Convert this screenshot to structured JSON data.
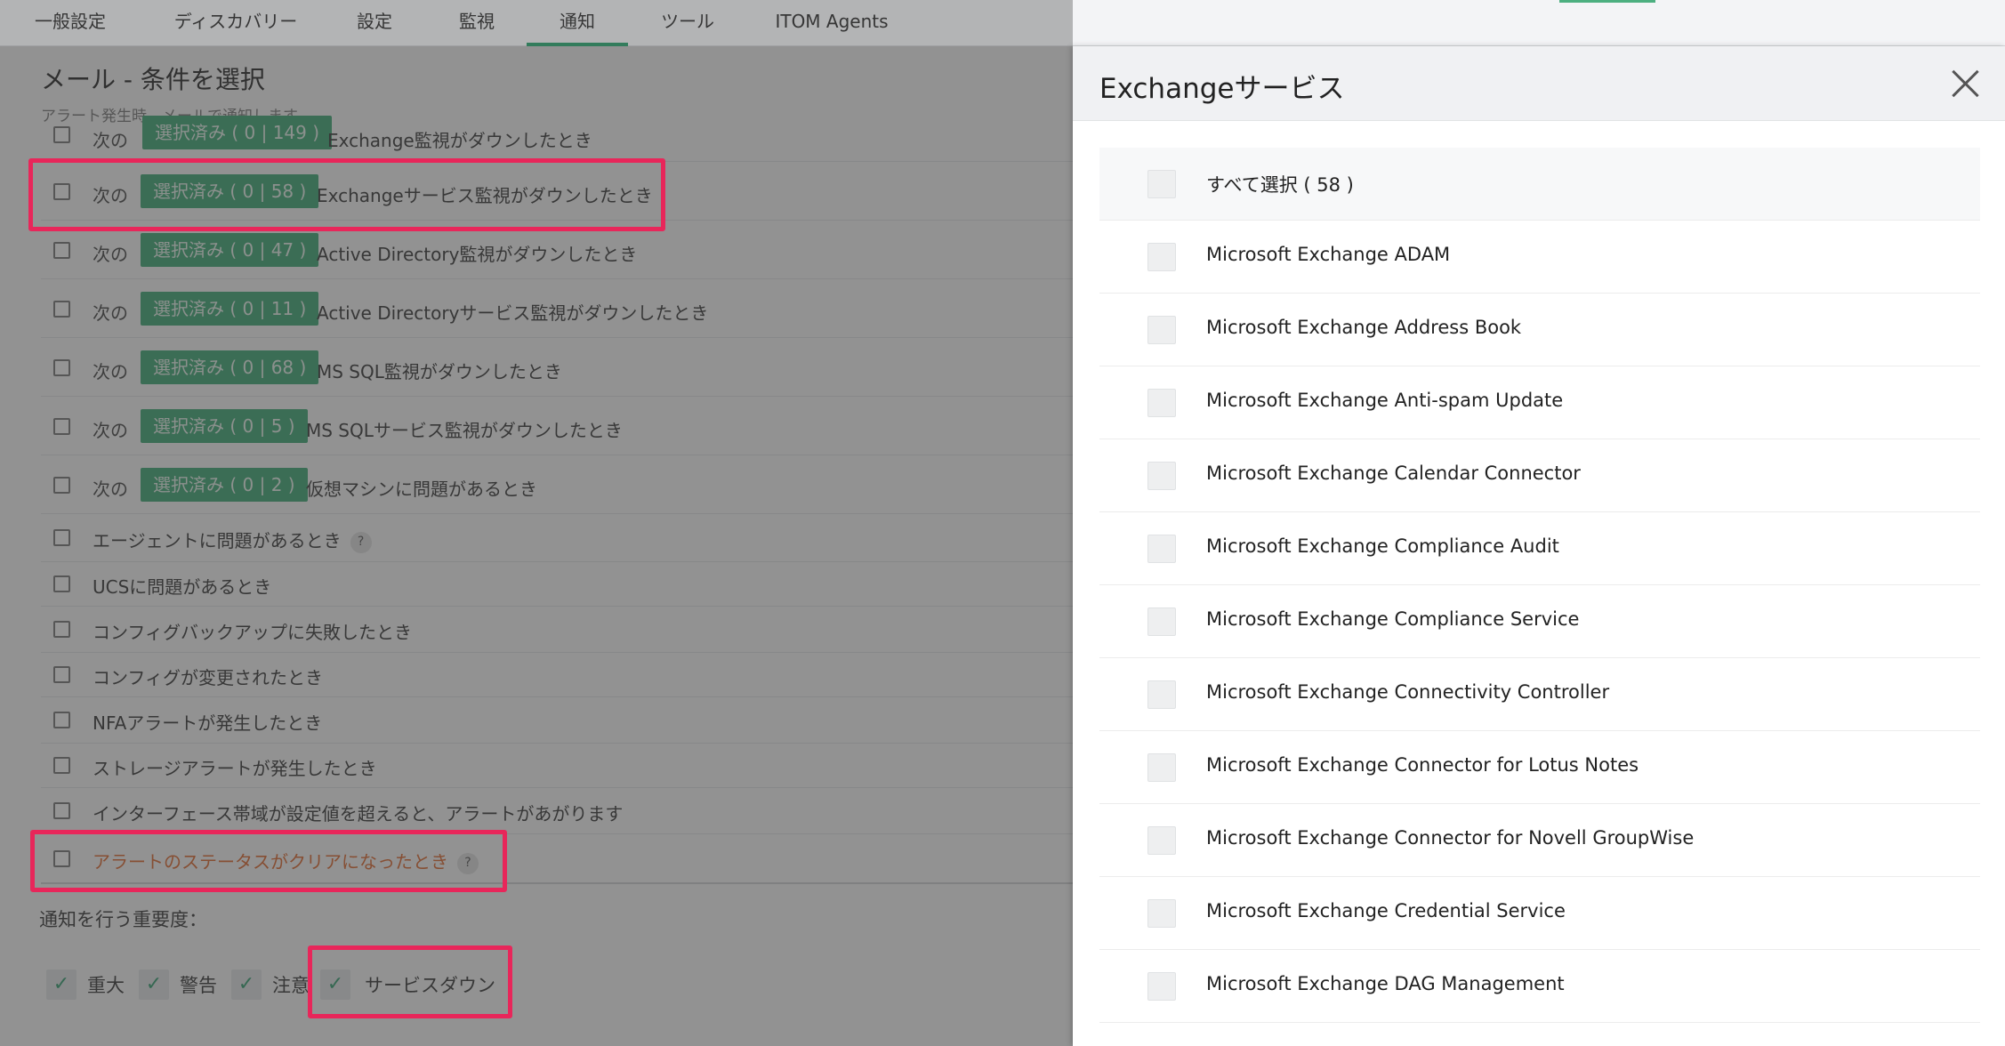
{
  "nav": {
    "tabs": [
      "一般設定",
      "ディスカバリー",
      "設定",
      "監視",
      "通知",
      "ツール",
      "ITOM Agents"
    ],
    "active": "通知"
  },
  "left": {
    "title": "メール - 条件を選択",
    "subtitle": "アラート発生時、メールで通知します。",
    "prefix": "次の",
    "rows": [
      {
        "badge": "選択済み ( 0 | 149 )",
        "label": "Exchange監視がダウンしたとき"
      },
      {
        "badge": "選択済み ( 0 | 58 )",
        "label": "Exchangeサービス監視がダウンしたとき"
      },
      {
        "badge": "選択済み ( 0 | 47 )",
        "label": "Active Directory監視がダウンしたとき"
      },
      {
        "badge": "選択済み ( 0 | 11 )",
        "label": "Active Directoryサービス監視がダウンしたとき"
      },
      {
        "badge": "選択済み ( 0 | 68 )",
        "label": "MS SQL監視がダウンしたとき"
      },
      {
        "badge": "選択済み ( 0 | 5 )",
        "label": "MS SQLサービス監視がダウンしたとき"
      },
      {
        "badge": "選択済み ( 0 | 2 )",
        "label": "仮想マシンに問題があるとき"
      }
    ],
    "simple_rows": [
      {
        "label": "エージェントに問題があるとき",
        "help": "?"
      },
      {
        "label": "UCSに問題があるとき"
      },
      {
        "label": "コンフィグバックアップに失敗したとき"
      },
      {
        "label": "コンフィグが変更されたとき"
      },
      {
        "label": "NFAアラートが発生したとき"
      },
      {
        "label": "ストレージアラートが発生したとき"
      },
      {
        "label": "インターフェース帯域が設定値を超えると、アラートがあがります"
      },
      {
        "label": "アラートのステータスがクリアになったとき",
        "help": "?",
        "color": "#e0662a"
      }
    ],
    "severity_title": "通知を行う重要度：",
    "severities": [
      {
        "label": "重大",
        "checked": true
      },
      {
        "label": "警告",
        "checked": true
      },
      {
        "label": "注意",
        "checked": true
      },
      {
        "label": "サービスダウン",
        "checked": true
      }
    ],
    "check_glyph": "✓"
  },
  "panel": {
    "title": "Exchangeサービス",
    "select_all": "すべて選択 ( 58 )",
    "items": [
      "Microsoft Exchange ADAM",
      "Microsoft Exchange Address Book",
      "Microsoft Exchange Anti-spam Update",
      "Microsoft Exchange Calendar Connector",
      "Microsoft Exchange Compliance Audit",
      "Microsoft Exchange Compliance Service",
      "Microsoft Exchange Connectivity Controller",
      "Microsoft Exchange Connector for Lotus Notes",
      "Microsoft Exchange Connector for Novell GroupWise",
      "Microsoft Exchange Credential Service",
      "Microsoft Exchange DAG Management"
    ]
  },
  "colors": {
    "accent": "#2f9e6e",
    "badge": "#3aa873",
    "highlight": "#e8265a",
    "warn_text": "#e0662a"
  }
}
